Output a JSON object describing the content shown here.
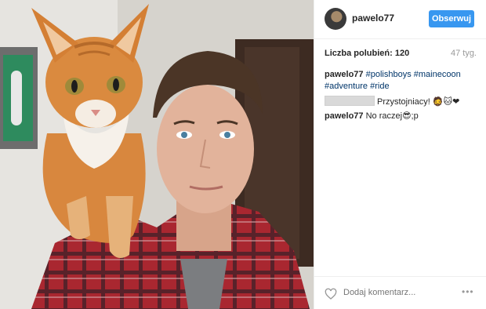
{
  "post": {
    "username": "pawelo77",
    "follow_label": "Obserwuj",
    "likes_label": "Liczba polubień: 120",
    "age": "47 tyg.",
    "caption": {
      "user": "pawelo77",
      "tags": [
        "#polishboys",
        "#mainecoon",
        "#adventure",
        "#ride"
      ]
    },
    "comments": [
      {
        "user_redacted": true,
        "text": "Przystojniacy!",
        "emojis": "🧔🐱❤"
      },
      {
        "user": "pawelo77",
        "text": "No raczej",
        "emojis": "😎",
        "suffix": ";p"
      }
    ],
    "add_comment_placeholder": "Dodaj komentarz...",
    "more_label": "•••"
  },
  "colors": {
    "accent": "#3897f0",
    "tag": "#003569",
    "muted": "#999999",
    "text": "#262626"
  },
  "icons": [
    "heart-icon",
    "more-options-icon"
  ]
}
